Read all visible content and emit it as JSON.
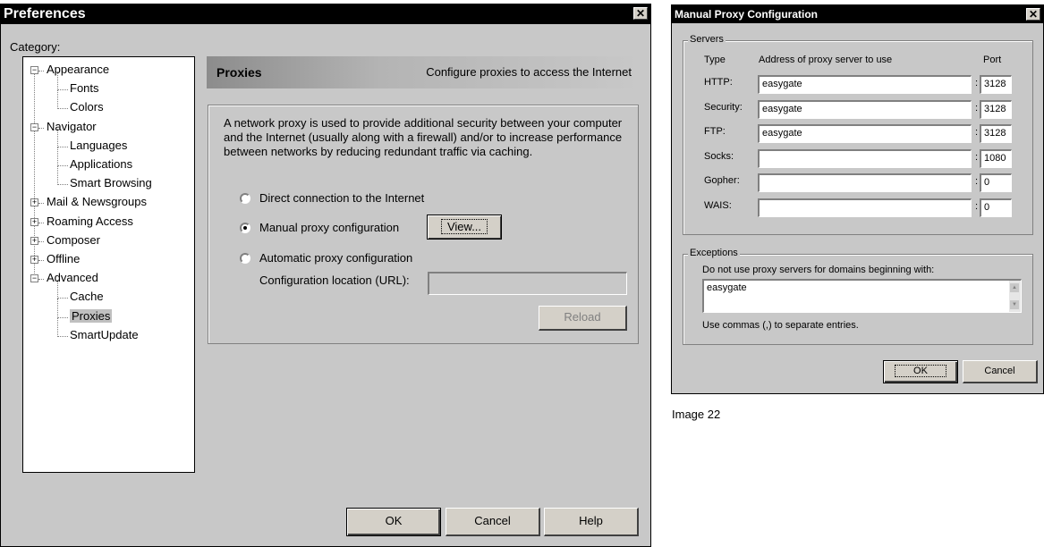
{
  "preferences": {
    "title": "Preferences",
    "category_label": "Category:",
    "tree": [
      {
        "label": "Appearance",
        "expander": "minus"
      },
      {
        "label": "Fonts"
      },
      {
        "label": "Colors"
      },
      {
        "label": "Navigator",
        "expander": "minus"
      },
      {
        "label": "Languages"
      },
      {
        "label": "Applications"
      },
      {
        "label": "Smart Browsing"
      },
      {
        "label": "Mail & Newsgroups",
        "expander": "plus"
      },
      {
        "label": "Roaming Access",
        "expander": "plus"
      },
      {
        "label": "Composer",
        "expander": "plus"
      },
      {
        "label": "Offline",
        "expander": "plus"
      },
      {
        "label": "Advanced",
        "expander": "minus"
      },
      {
        "label": "Cache"
      },
      {
        "label": "Proxies",
        "selected": true
      },
      {
        "label": "SmartUpdate"
      }
    ],
    "panel_title": "Proxies",
    "panel_subtitle": "Configure proxies to access the Internet",
    "description": "A network proxy is used to provide additional security between your computer and the Internet (usually along with a firewall) and/or to increase performance between networks by reducing redundant traffic via caching.",
    "options": {
      "direct": "Direct connection to the Internet",
      "manual": "Manual proxy configuration",
      "automatic": "Automatic proxy configuration",
      "selected": "manual"
    },
    "view_button": "View...",
    "config_location_label": "Configuration location (URL):",
    "config_location_value": "",
    "reload_button": "Reload",
    "ok_button": "OK",
    "cancel_button": "Cancel",
    "help_button": "Help",
    "colors": {
      "title_bar": "#000000",
      "window": "#c8c8c8",
      "panel_header": "#9a9a9a"
    }
  },
  "manual_proxy": {
    "title": "Manual Proxy Configuration",
    "servers_group": "Servers",
    "col_type": "Type",
    "col_address": "Address of proxy server to use",
    "col_port": "Port",
    "rows": [
      {
        "label": "HTTP:",
        "address": "easygate",
        "port": "3128"
      },
      {
        "label": "Security:",
        "address": "easygate",
        "port": "3128"
      },
      {
        "label": "FTP:",
        "address": "easygate",
        "port": "3128"
      },
      {
        "label": "Socks:",
        "address": "",
        "port": "1080"
      },
      {
        "label": "Gopher:",
        "address": "",
        "port": "0"
      },
      {
        "label": "WAIS:",
        "address": "",
        "port": "0"
      }
    ],
    "exceptions_group": "Exceptions",
    "exceptions_label": "Do not use proxy servers for domains beginning with:",
    "exceptions_value": "easygate",
    "exceptions_hint": "Use commas (,) to separate entries.",
    "ok_button": "OK",
    "cancel_button": "Cancel"
  },
  "caption": "Image 22"
}
